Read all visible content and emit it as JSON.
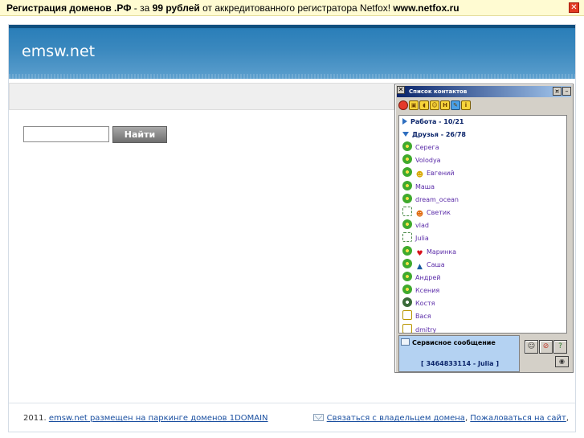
{
  "promo_bar": {
    "part1": "Регистрация доменов .РФ",
    "part2": " - за ",
    "part3": "99 рублей",
    "part4": " от аккредитованного регистратора Netfox! ",
    "part5": "www.netfox.ru",
    "close_icon": "close-icon",
    "close_color": "#e23b22"
  },
  "header": {
    "site_title": "emsw.net",
    "color": "#3a88be"
  },
  "search": {
    "value": "",
    "button_label": "Найти"
  },
  "footer": {
    "year": "2011. ",
    "parking_link": "emsw.net размещен на паркинге доменов 1DOMAIN",
    "contact_owner": "Связаться с владельцем домена",
    "separator": ", ",
    "complain": "Пожаловаться на сайт",
    "tail": ","
  },
  "contact_widget": {
    "title": "Список контактов",
    "groups": [
      {
        "name": "Работа",
        "sep": " - ",
        "count": "10/21",
        "expanded": false
      },
      {
        "name": "Друзья",
        "sep": " - ",
        "count": "26/78",
        "expanded": true
      }
    ],
    "contacts": [
      {
        "name": "Серега",
        "status_icon": "online-flower-icon"
      },
      {
        "name": "Volodya",
        "status_icon": "online-flower-icon"
      },
      {
        "name": "Евгений",
        "status_icon": "online-flower-icon",
        "extra_icon": "smiley-icon"
      },
      {
        "name": "Маша",
        "status_icon": "online-flower-icon"
      },
      {
        "name": "dream_ocean",
        "status_icon": "online-flower-icon"
      },
      {
        "name": "Светик",
        "status_icon": "offline-icon",
        "extra_icon": "smiley-icon"
      },
      {
        "name": "vlad",
        "status_icon": "online-flower-icon"
      },
      {
        "name": "Julia",
        "status_icon": "offline-icon"
      },
      {
        "name": "Маринка",
        "status_icon": "online-flower-icon",
        "extra_icon": "heart-icon"
      },
      {
        "name": "Саша",
        "status_icon": "online-flower-icon",
        "extra_icon": "graduation-cap-icon"
      },
      {
        "name": "Андрей",
        "status_icon": "online-flower-icon"
      },
      {
        "name": "Ксения",
        "status_icon": "online-flower-icon"
      },
      {
        "name": "Костя",
        "status_icon": "na-flower-icon"
      },
      {
        "name": "Вася",
        "status_icon": "away-icon"
      },
      {
        "name": "dmitry",
        "status_icon": "away-icon"
      }
    ],
    "service": {
      "title": "Сервисное сообщение",
      "message": "[ 3464833114 - Julia ]"
    }
  }
}
